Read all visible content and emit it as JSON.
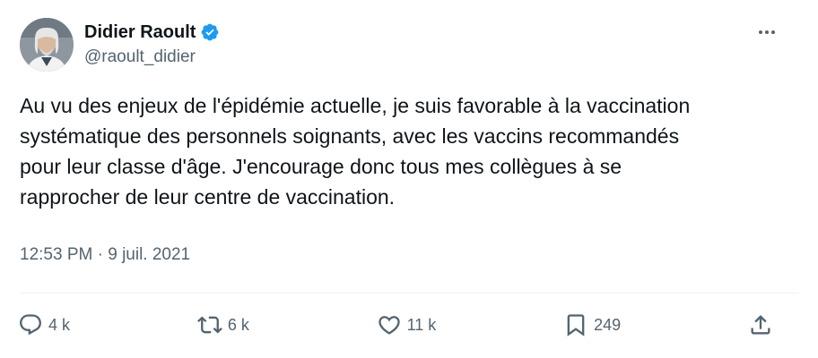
{
  "author": {
    "name": "Didier Raoult",
    "handle": "@raoult_didier"
  },
  "tweet": {
    "text": "Au vu des enjeux de l'épidémie actuelle, je suis favorable à la vaccination\nsystématique des personnels soignants, avec les vaccins recommandés\npour leur classe d'âge. J'encourage donc tous mes collègues à se\nrapprocher de leur centre de vaccination.",
    "time": "12:53 PM",
    "separator": " · ",
    "date": "9 juil. 2021"
  },
  "actions": {
    "replies": "4 k",
    "reposts": "6 k",
    "likes": "11 k",
    "bookmarks": "249"
  },
  "colors": {
    "verified": "#1d9bf0",
    "secondary_text": "#536471",
    "primary_text": "#0f1419"
  },
  "icons": [
    "verified-badge-icon",
    "more-icon",
    "reply-icon",
    "repost-icon",
    "like-icon",
    "bookmark-icon",
    "share-icon"
  ]
}
